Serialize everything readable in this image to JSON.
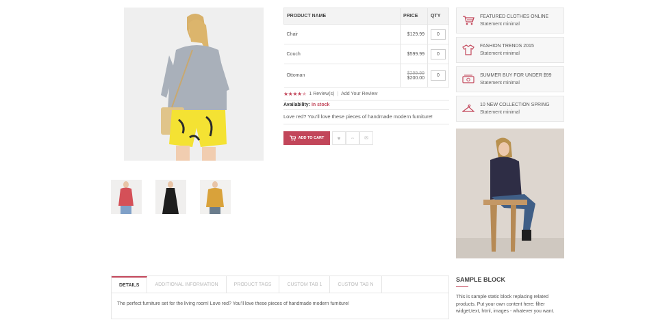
{
  "product": {
    "grouped_table": {
      "headers": [
        "PRODUCT NAME",
        "PRICE",
        "QTY"
      ],
      "rows": [
        {
          "name": "Chair",
          "price": "$129.99",
          "old_price": "",
          "qty": "0"
        },
        {
          "name": "Couch",
          "price": "$599.99",
          "old_price": "",
          "qty": "0"
        },
        {
          "name": "Ottoman",
          "price": "$200.00",
          "old_price": "$299.99",
          "qty": "0"
        }
      ]
    },
    "rating": {
      "stars": 4.5,
      "reviews_label": "1 Review(s)",
      "separator": "|",
      "add_review_label": "Add Your Review"
    },
    "availability": {
      "label": "Availability:",
      "value": "In stock"
    },
    "short_description": "Love red? You'll love these pieces of handmade modern furniture!",
    "actions": {
      "add_to_cart": "ADD TO CART",
      "icons": [
        "heart-icon",
        "compare-icon",
        "email-icon"
      ]
    }
  },
  "gallery": {
    "main_image": "woman-yellow-shorts-photo",
    "thumbnails": [
      "red-sweater-thumbnail",
      "black-dress-thumbnail",
      "mustard-sweater-thumbnail"
    ]
  },
  "features": [
    {
      "icon": "cart-icon",
      "title": "FEATURED CLOTHES ONLINE",
      "subtitle": "Statement minimal"
    },
    {
      "icon": "shirt-icon",
      "title": "FASHION TRENDS 2015",
      "subtitle": "Statement minimal"
    },
    {
      "icon": "money-icon",
      "title": "SUMMER BUY FOR UNDER $99",
      "subtitle": "Statement minimal"
    },
    {
      "icon": "hanger-icon",
      "title": "10 NEW COLLECTION SPRING",
      "subtitle": "Statement minimal"
    }
  ],
  "tabs": {
    "labels": [
      "DETAILS",
      "ADDITIONAL INFORMATION",
      "PRODUCT TAGS",
      "CUSTOM TAB 1",
      "CUSTOM TAB N"
    ],
    "active_index": 0,
    "content": "The perfect furniture set for the living room! Love red? You'll love these pieces of handmade modern furniture!"
  },
  "sample_block": {
    "title": "SAMPLE BLOCK",
    "text": "This is sample static block replacing related products. Put your own content here: filter widget,text, html, images - whatever you want."
  },
  "colors": {
    "accent": "#c2465a",
    "border": "#e5e5e5",
    "header_bg": "#f3f3f3"
  }
}
